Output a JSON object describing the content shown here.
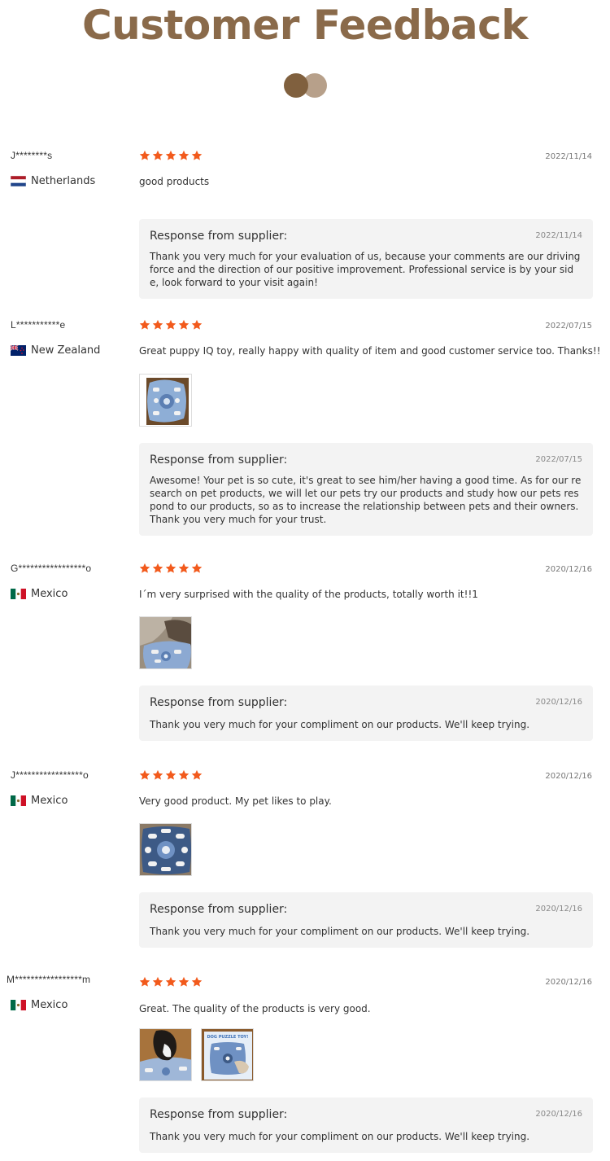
{
  "page_title": "Customer Feedback",
  "colors": {
    "title": "#8a6a4a",
    "dot_dark": "#80603e",
    "dot_light": "#b7a08a",
    "star": "#f25a1c",
    "response_bg": "#f3f3f3"
  },
  "response_label": "Response from supplier:",
  "reviews": [
    {
      "reviewer": "J********s",
      "country": "Netherlands",
      "flag": "netherlands-flag-icon",
      "stars": 5,
      "date": "2022/11/14",
      "comment": "good products",
      "photos": [],
      "response_date": "2022/11/14",
      "response_text": "Thank you very much for your evaluation of us, because your comments are our driving force and the direction of our positive improvement. Professional service is by your side, look forward to your visit again!"
    },
    {
      "reviewer": "L***********e",
      "country": "New Zealand",
      "flag": "new-zealand-flag-icon",
      "stars": 5,
      "date": "2022/07/15",
      "comment": "Great puppy IQ toy, really happy with quality of item and good customer service too. Thanks!!",
      "photos": [
        "puzzle-toy-photo"
      ],
      "response_date": "2022/07/15",
      "response_text": "Awesome! Your pet is so cute, it's great to see him/her having a good time. As for our research on pet products, we will let our pets try our products and study how our pets respond to our products, so as to increase the relationship between pets and their owners. Thank you very much for your trust."
    },
    {
      "reviewer": "G*****************o",
      "country": "Mexico",
      "flag": "mexico-flag-icon",
      "stars": 5,
      "date": "2020/12/16",
      "comment": "I´m very surprised with the quality of the products, totally worth it!!1",
      "photos": [
        "dog-with-toy-photo"
      ],
      "response_date": "2020/12/16",
      "response_text": "Thank you very much for your compliment on our products. We'll keep trying."
    },
    {
      "reviewer": "J*****************o",
      "country": "Mexico",
      "flag": "mexico-flag-icon",
      "stars": 5,
      "date": "2020/12/16",
      "comment": "Very good product. My pet likes to play.",
      "photos": [
        "puzzle-toy-top-photo"
      ],
      "response_date": "2020/12/16",
      "response_text": "Thank you very much for your compliment on our products. We'll keep trying."
    },
    {
      "reviewer": "M*****************m",
      "country": "Mexico",
      "flag": "mexico-flag-icon",
      "stars": 5,
      "date": "2020/12/16",
      "comment": "Great. The quality of the products is very good.",
      "photos": [
        "dog-playing-photo",
        "product-box-photo"
      ],
      "box_text": "DOG PUZZLE TOY!",
      "response_date": "2020/12/16",
      "response_text": "Thank you very much for your compliment on our products. We'll keep trying."
    }
  ]
}
